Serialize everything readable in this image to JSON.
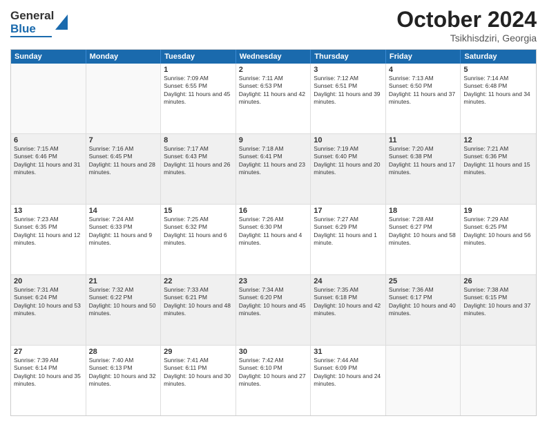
{
  "header": {
    "logo_general": "General",
    "logo_blue": "Blue",
    "title": "October 2024",
    "subtitle": "Tsikhisdziri, Georgia"
  },
  "days": [
    "Sunday",
    "Monday",
    "Tuesday",
    "Wednesday",
    "Thursday",
    "Friday",
    "Saturday"
  ],
  "weeks": [
    [
      {
        "day": "",
        "info": ""
      },
      {
        "day": "",
        "info": ""
      },
      {
        "day": "1",
        "info": "Sunrise: 7:09 AM\nSunset: 6:55 PM\nDaylight: 11 hours and 45 minutes."
      },
      {
        "day": "2",
        "info": "Sunrise: 7:11 AM\nSunset: 6:53 PM\nDaylight: 11 hours and 42 minutes."
      },
      {
        "day": "3",
        "info": "Sunrise: 7:12 AM\nSunset: 6:51 PM\nDaylight: 11 hours and 39 minutes."
      },
      {
        "day": "4",
        "info": "Sunrise: 7:13 AM\nSunset: 6:50 PM\nDaylight: 11 hours and 37 minutes."
      },
      {
        "day": "5",
        "info": "Sunrise: 7:14 AM\nSunset: 6:48 PM\nDaylight: 11 hours and 34 minutes."
      }
    ],
    [
      {
        "day": "6",
        "info": "Sunrise: 7:15 AM\nSunset: 6:46 PM\nDaylight: 11 hours and 31 minutes."
      },
      {
        "day": "7",
        "info": "Sunrise: 7:16 AM\nSunset: 6:45 PM\nDaylight: 11 hours and 28 minutes."
      },
      {
        "day": "8",
        "info": "Sunrise: 7:17 AM\nSunset: 6:43 PM\nDaylight: 11 hours and 26 minutes."
      },
      {
        "day": "9",
        "info": "Sunrise: 7:18 AM\nSunset: 6:41 PM\nDaylight: 11 hours and 23 minutes."
      },
      {
        "day": "10",
        "info": "Sunrise: 7:19 AM\nSunset: 6:40 PM\nDaylight: 11 hours and 20 minutes."
      },
      {
        "day": "11",
        "info": "Sunrise: 7:20 AM\nSunset: 6:38 PM\nDaylight: 11 hours and 17 minutes."
      },
      {
        "day": "12",
        "info": "Sunrise: 7:21 AM\nSunset: 6:36 PM\nDaylight: 11 hours and 15 minutes."
      }
    ],
    [
      {
        "day": "13",
        "info": "Sunrise: 7:23 AM\nSunset: 6:35 PM\nDaylight: 11 hours and 12 minutes."
      },
      {
        "day": "14",
        "info": "Sunrise: 7:24 AM\nSunset: 6:33 PM\nDaylight: 11 hours and 9 minutes."
      },
      {
        "day": "15",
        "info": "Sunrise: 7:25 AM\nSunset: 6:32 PM\nDaylight: 11 hours and 6 minutes."
      },
      {
        "day": "16",
        "info": "Sunrise: 7:26 AM\nSunset: 6:30 PM\nDaylight: 11 hours and 4 minutes."
      },
      {
        "day": "17",
        "info": "Sunrise: 7:27 AM\nSunset: 6:29 PM\nDaylight: 11 hours and 1 minute."
      },
      {
        "day": "18",
        "info": "Sunrise: 7:28 AM\nSunset: 6:27 PM\nDaylight: 10 hours and 58 minutes."
      },
      {
        "day": "19",
        "info": "Sunrise: 7:29 AM\nSunset: 6:25 PM\nDaylight: 10 hours and 56 minutes."
      }
    ],
    [
      {
        "day": "20",
        "info": "Sunrise: 7:31 AM\nSunset: 6:24 PM\nDaylight: 10 hours and 53 minutes."
      },
      {
        "day": "21",
        "info": "Sunrise: 7:32 AM\nSunset: 6:22 PM\nDaylight: 10 hours and 50 minutes."
      },
      {
        "day": "22",
        "info": "Sunrise: 7:33 AM\nSunset: 6:21 PM\nDaylight: 10 hours and 48 minutes."
      },
      {
        "day": "23",
        "info": "Sunrise: 7:34 AM\nSunset: 6:20 PM\nDaylight: 10 hours and 45 minutes."
      },
      {
        "day": "24",
        "info": "Sunrise: 7:35 AM\nSunset: 6:18 PM\nDaylight: 10 hours and 42 minutes."
      },
      {
        "day": "25",
        "info": "Sunrise: 7:36 AM\nSunset: 6:17 PM\nDaylight: 10 hours and 40 minutes."
      },
      {
        "day": "26",
        "info": "Sunrise: 7:38 AM\nSunset: 6:15 PM\nDaylight: 10 hours and 37 minutes."
      }
    ],
    [
      {
        "day": "27",
        "info": "Sunrise: 7:39 AM\nSunset: 6:14 PM\nDaylight: 10 hours and 35 minutes."
      },
      {
        "day": "28",
        "info": "Sunrise: 7:40 AM\nSunset: 6:13 PM\nDaylight: 10 hours and 32 minutes."
      },
      {
        "day": "29",
        "info": "Sunrise: 7:41 AM\nSunset: 6:11 PM\nDaylight: 10 hours and 30 minutes."
      },
      {
        "day": "30",
        "info": "Sunrise: 7:42 AM\nSunset: 6:10 PM\nDaylight: 10 hours and 27 minutes."
      },
      {
        "day": "31",
        "info": "Sunrise: 7:44 AM\nSunset: 6:09 PM\nDaylight: 10 hours and 24 minutes."
      },
      {
        "day": "",
        "info": ""
      },
      {
        "day": "",
        "info": ""
      }
    ]
  ]
}
